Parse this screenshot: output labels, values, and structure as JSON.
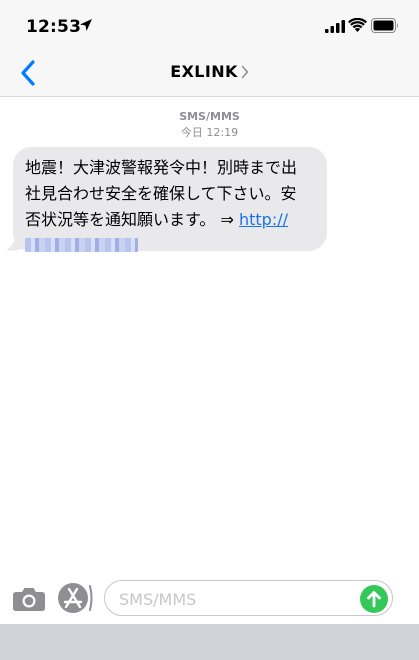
{
  "status_bar": {
    "time": "12:53",
    "icons": [
      "location-arrow-icon",
      "cellular-signal-icon",
      "wifi-icon",
      "battery-icon"
    ]
  },
  "nav_bar": {
    "back_icon": "chevron-left-icon",
    "title": "EXLINK",
    "title_icon": "chevron-right-icon"
  },
  "conversation": {
    "service_label": "SMS/MMS",
    "timestamp": "今日 12:19",
    "messages": [
      {
        "line1": "地震！大津波警報発令中！別時まで出",
        "line2": "社見合わせ安全を確保して下さい。安",
        "line3_text": "否状況等を通知願います。 ⇒ ",
        "link_text": "http://"
      }
    ]
  },
  "input_bar": {
    "camera_icon": "camera-icon",
    "apps_icon": "app-store-icon",
    "placeholder": "SMS/MMS",
    "send_icon": "send-arrow-up-icon"
  },
  "colors": {
    "link": "#1a73e8",
    "bubble": "#e9e9eb",
    "send": "#34c759",
    "back": "#007aff"
  }
}
